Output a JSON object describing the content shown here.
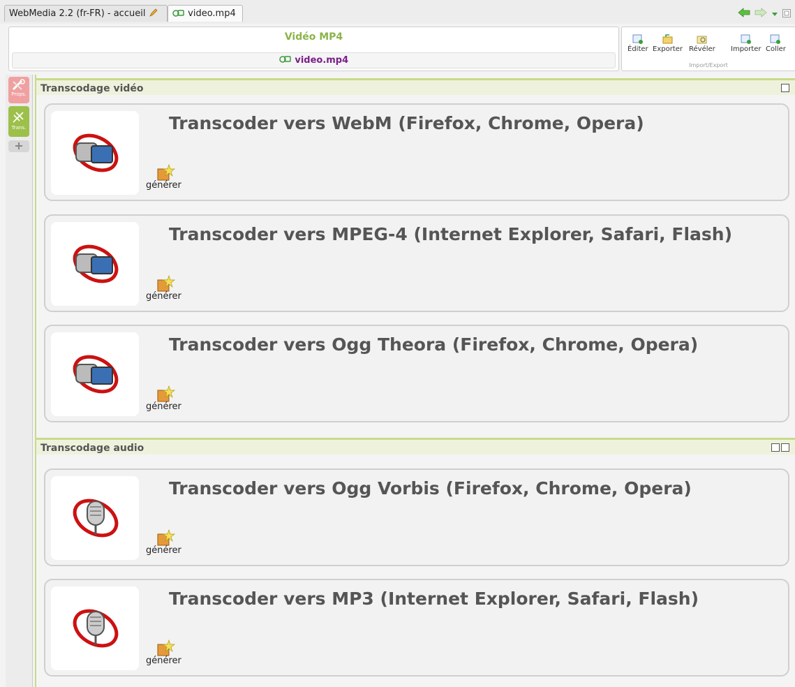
{
  "tabs": [
    {
      "label": "WebMedia 2.2 (fr-FR) - accueil"
    },
    {
      "label": "video.mp4"
    }
  ],
  "header": {
    "title": "Vidéo MP4",
    "document_name": "video.mp4"
  },
  "toolbar": {
    "buttons": [
      {
        "label": "Éditer",
        "icon": "edit-icon"
      },
      {
        "label": "Exporter",
        "icon": "export-icon"
      },
      {
        "label": "Révéler",
        "icon": "reveal-icon"
      },
      {
        "label": "Importer",
        "icon": "import-icon"
      },
      {
        "label": "Coller",
        "icon": "paste-icon"
      }
    ],
    "group_label": "Import/Export"
  },
  "sidebar": {
    "items": [
      {
        "label": "Props."
      },
      {
        "label": "Trans."
      },
      {
        "label": ""
      }
    ]
  },
  "sections": [
    {
      "title": "Transcodage vidéo",
      "cards": [
        {
          "title": "Transcoder vers WebM (Firefox, Chrome, Opera)",
          "action": "générer"
        },
        {
          "title": "Transcoder vers MPEG-4 (Internet Explorer, Safari, Flash)",
          "action": "générer"
        },
        {
          "title": "Transcoder vers Ogg Theora (Firefox, Chrome, Opera)",
          "action": "générer"
        }
      ]
    },
    {
      "title": "Transcodage audio",
      "cards": [
        {
          "title": "Transcoder vers Ogg Vorbis (Firefox, Chrome, Opera)",
          "action": "générer"
        },
        {
          "title": "Transcoder vers MP3 (Internet Explorer, Safari, Flash)",
          "action": "générer"
        }
      ]
    }
  ],
  "colors": {
    "accent_green": "#8cb34a",
    "doc_purple": "#7a1f8a",
    "transcode_red": "#cc1111"
  }
}
